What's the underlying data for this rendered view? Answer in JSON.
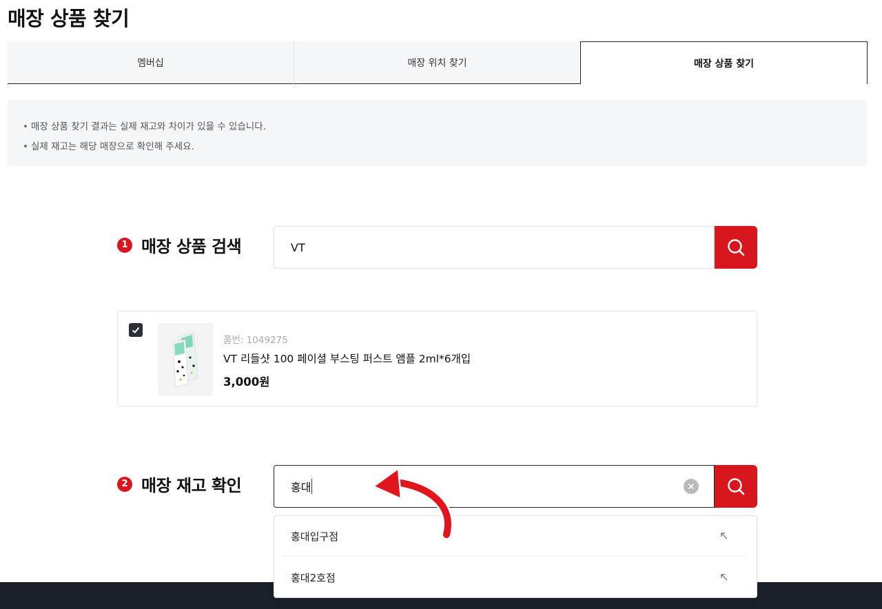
{
  "page": {
    "title": "매장 상품 찾기"
  },
  "tabs": [
    {
      "label": "멤버십"
    },
    {
      "label": "매장 위치 찾기"
    },
    {
      "label": "매장 상품 찾기"
    }
  ],
  "notice": {
    "items": [
      "매장 상품 찾기 결과는 실제 재고와 차이가 있을 수 있습니다.",
      "실제 재고는 해당 매장으로 확인해 주세요."
    ]
  },
  "product_search": {
    "number": "1",
    "label": "매장 상품 검색",
    "value": "VT"
  },
  "product": {
    "checked": true,
    "code": "품번: 1049275",
    "name": "VT 리들샷 100 페이셜 부스팅 퍼스트 앰플 2ml*6개입",
    "price": "3,000원"
  },
  "stock_search": {
    "number": "2",
    "label": "매장 재고 확인",
    "value": "홍대",
    "suggestions": [
      {
        "label": "홍대입구점"
      },
      {
        "label": "홍대2호점"
      }
    ]
  },
  "icons": {
    "search": "search-icon",
    "clear": "clear-icon",
    "check": "check-icon",
    "suggestion_arrow": "arrow-up-left-icon",
    "annotation": "curved-arrow-annotation"
  },
  "colors": {
    "accent": "#d7161e",
    "footer": "#1b1f27",
    "panel_bg": "#f6f7f9",
    "annotation": "#e0161e"
  }
}
